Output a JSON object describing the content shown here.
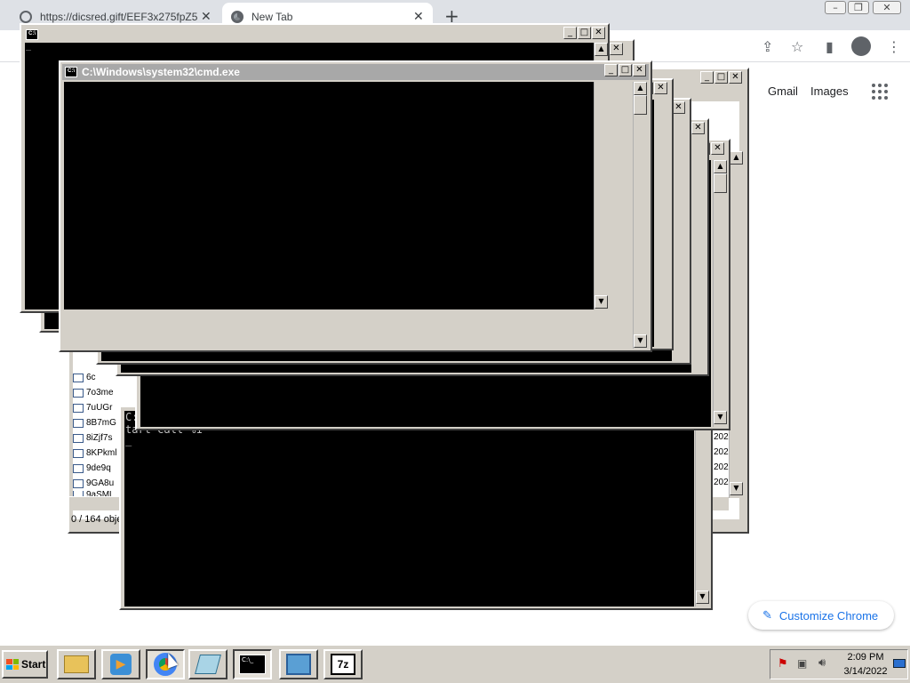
{
  "browser": {
    "tabs": [
      {
        "label": "https://dicsred.gift/EEF3x275fpZ5",
        "active": false
      },
      {
        "label": "New Tab",
        "active": true
      }
    ],
    "new_tab_symbol": "+",
    "close_symbol": "✕",
    "links": {
      "gmail": "Gmail",
      "images": "Images"
    },
    "customize_label": "Customize Chrome",
    "accent_color": "#1a73e8"
  },
  "windows": {
    "cmd_active_title": "C:\\Windows\\system32\\cmd.exe",
    "cmd_prompt_fragment": "C:",
    "cmd_text_fragment": "tart Call %1",
    "cursor": "_"
  },
  "explorer": {
    "files": [
      "6c",
      "7o3me",
      "7uUGr",
      "8B7mG",
      "8iZjf7s",
      "8KPkml",
      "9de9q",
      "9GA8u",
      "9aSMl"
    ],
    "dates": [
      "202",
      "202",
      "202",
      "202",
      "202"
    ],
    "status_text": "0 / 164 obje"
  },
  "taskbar": {
    "start_label": "Start",
    "clock_time": "2:09 PM",
    "clock_date": "3/14/2022",
    "icons": [
      "explorer-icon",
      "media-player-icon",
      "chrome-icon",
      "notepad-icon",
      "cmd-icon",
      "control-panel-icon",
      "7zip-icon"
    ]
  }
}
